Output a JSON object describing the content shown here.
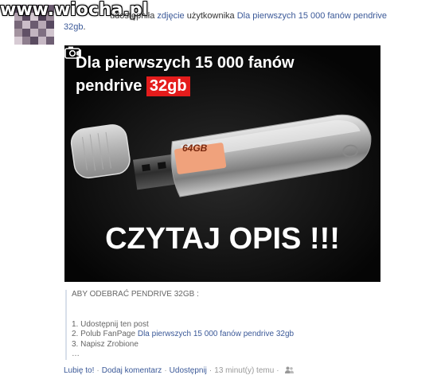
{
  "watermark": "www.wiocha.pl",
  "story": {
    "prefix": "…",
    "verb": "udostępniła",
    "object_link": "zdjęcie",
    "middle": "użytkownika",
    "page_link": "Dla pierwszych 15 000 fanów pendrive 32gb",
    "suffix": "."
  },
  "photo": {
    "headline_line1": "Dla pierwszych 15 000 fanów",
    "headline_line2_prefix": "pendrive",
    "headline_highlight": "32gb",
    "usb_label": "64GB",
    "caption": "CZYTAJ OPIS !!!",
    "camera_icon": "camera-icon"
  },
  "description": {
    "heading": "ABY ODEBRAĆ PENDRIVE 32GB :",
    "blank": "",
    "step1": "1. Udostępnij ten post",
    "step2_prefix": "2. Polub FanPage",
    "step2_link": "Dla pierwszych 15 000 fanów pendrive 32gb",
    "step3": "3. Napisz Zrobione",
    "ellipsis": "…"
  },
  "footer": {
    "like": "Lubię to!",
    "comment": "Dodaj komentarz",
    "share": "Udostępnij",
    "time": "13 minut(y) temu",
    "privacy_icon": "friends-icon"
  },
  "colors": {
    "link": "#3b5998",
    "highlight": "#e41c1c",
    "quote_border": "#d8dfea"
  }
}
